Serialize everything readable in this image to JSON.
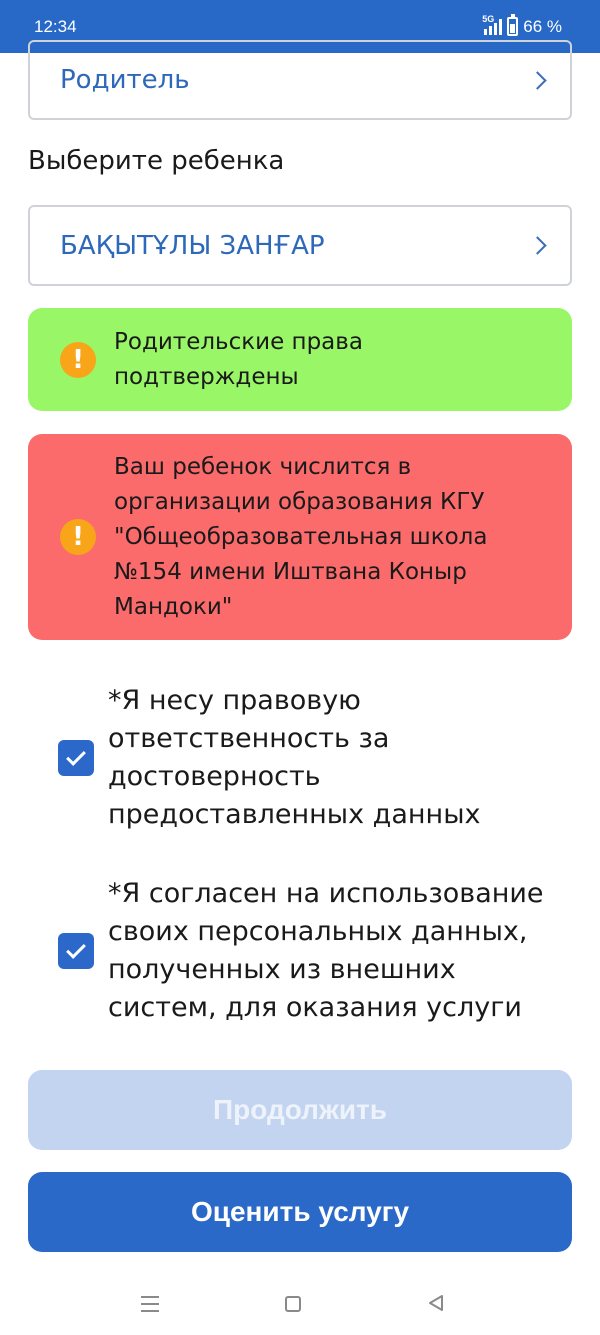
{
  "status_bar": {
    "time": "12:34",
    "network": "5G",
    "battery": "66 %"
  },
  "form": {
    "applicant_type": "Родитель",
    "child_label": "Выберите ребенка",
    "child_value": "БАҚЫТҰЛЫ ЗАНҒАР"
  },
  "alerts": {
    "success_text": "Родительские права подтверждены",
    "error_text": "Ваш ребенок числится в организации образования КГУ \"Общеобразовательная школа №154 имени Иштвана Коныр Мандоки\""
  },
  "consents": {
    "legal_text": "*Я несу правовую ответственность за достоверность предоставленных данных",
    "legal_checked": true,
    "personal_text": "*Я согласен на использование своих персональных данных, полученных из внешних систем, для оказания услуги",
    "personal_checked": true
  },
  "buttons": {
    "continue_label": "Продолжить",
    "rate_label": "Оценить услугу"
  },
  "colors": {
    "brand_blue": "#2b69c9",
    "success_green": "#99f767",
    "error_red": "#fb6b6b",
    "warning_orange": "#f9a519",
    "disabled_blue": "#c2d4ef"
  }
}
